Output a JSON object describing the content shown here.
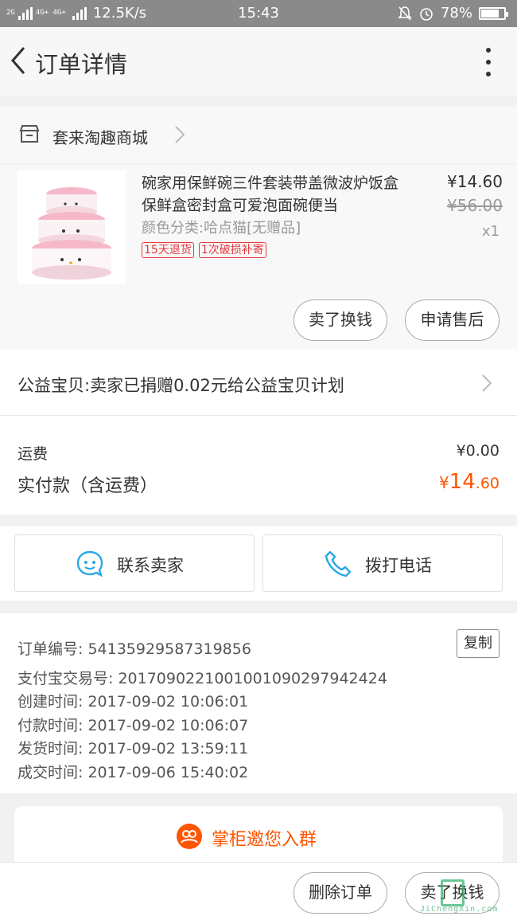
{
  "status_bar": {
    "network_1": "2G",
    "network_2": "4G+ 4G+",
    "network_3": "2G",
    "speed": "12.5K/s",
    "time": "15:43",
    "battery": "78%",
    "battery_level": 0.78
  },
  "header": {
    "title": "订单详情"
  },
  "shop": {
    "name": "套来淘趣商城"
  },
  "product": {
    "title": "碗家用保鲜碗三件套装带盖微波炉饭盒保鲜盒密封盒可爱泡面碗便当",
    "sku": "颜色分类:哈点猫[无赠品]",
    "tags": [
      "15天退货",
      "1次破损补寄"
    ],
    "price": "¥14.60",
    "original_price": "¥56.00",
    "quantity": "x1",
    "sell_button": "卖了换钱",
    "after_sale_button": "申请售后"
  },
  "charity": {
    "text": "公益宝贝:卖家已捐赠0.02元给公益宝贝计划"
  },
  "fees": {
    "shipping_label": "运费",
    "shipping_value": "¥0.00",
    "paid_label": "实付款（含运费）",
    "paid_currency": "¥",
    "paid_int": "14",
    "paid_dec": ".60"
  },
  "contact": {
    "seller_label": "联系卖家",
    "call_label": "拨打电话"
  },
  "order_info": {
    "order_no": "订单编号: 54135929587319856",
    "copy_label": "复制",
    "alipay_no": "支付宝交易号: 2017090221001001090297942424",
    "created": "创建时间: 2017-09-02 10:06:01",
    "paid": "付款时间: 2017-09-02 10:06:07",
    "shipped": "发货时间: 2017-09-02 13:59:11",
    "completed": "成交时间: 2017-09-06 15:40:02"
  },
  "group_invite": {
    "label": "掌柜邀您入群"
  },
  "bottom_bar": {
    "delete_label": "删除订单",
    "sell_label": "卖了换钱"
  },
  "watermark": {
    "text": "JiChengXin.com"
  },
  "colors": {
    "accent": "#ff5500",
    "tag_red": "#e4393c",
    "icon_blue": "#2aa7e6"
  }
}
